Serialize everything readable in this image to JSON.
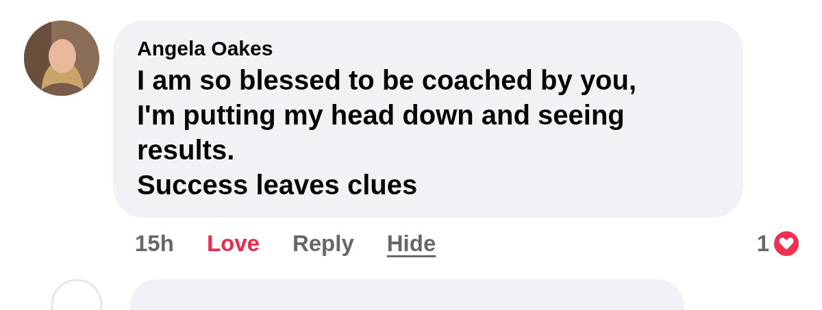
{
  "comment": {
    "author": "Angela Oakes",
    "lines": [
      "I am so blessed to be coached by you,",
      "I'm putting my head down and seeing",
      "results.",
      "Success leaves clues"
    ],
    "time": "15h",
    "actions": [
      {
        "label": "Love",
        "kind": "reaction",
        "selected": true
      },
      {
        "label": "Reply",
        "kind": "plain",
        "selected": false
      },
      {
        "label": "Hide",
        "kind": "underlined",
        "selected": false
      }
    ],
    "reaction_count": "1"
  }
}
